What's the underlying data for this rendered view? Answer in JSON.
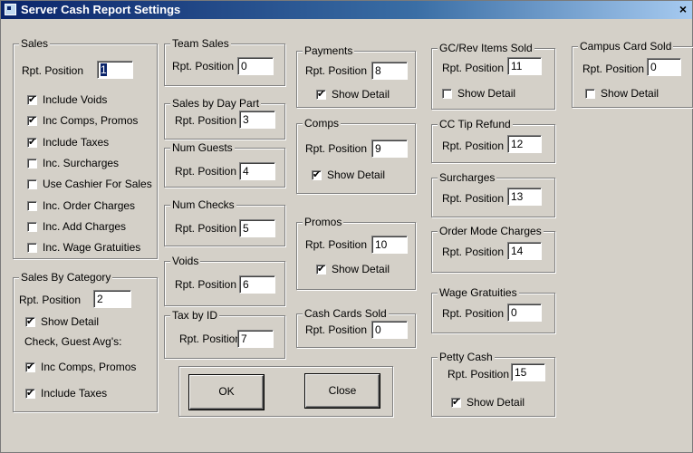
{
  "window": {
    "title": "Server Cash Report Settings",
    "close_glyph": "×"
  },
  "common": {
    "rpt_position_label": "Rpt. Position",
    "show_detail_label": "Show Detail"
  },
  "sales": {
    "title": "Sales",
    "rpt_position": "1",
    "checks": [
      {
        "label": "Include Voids",
        "checked": true
      },
      {
        "label": "Inc Comps, Promos",
        "checked": true
      },
      {
        "label": "Include Taxes",
        "checked": true
      },
      {
        "label": "Inc. Surcharges",
        "checked": false
      },
      {
        "label": "Use Cashier For Sales",
        "checked": false
      },
      {
        "label": "Inc. Order Charges",
        "checked": false
      },
      {
        "label": "Inc. Add Charges",
        "checked": false
      },
      {
        "label": "Inc. Wage Gratuities",
        "checked": false
      }
    ]
  },
  "sales_by_category": {
    "title": "Sales By Category",
    "rpt_position": "2",
    "show_detail": true,
    "avg_label": "Check, Guest Avg's:",
    "checks": [
      {
        "label": "Inc Comps, Promos",
        "checked": true
      },
      {
        "label": "Include Taxes",
        "checked": true
      }
    ]
  },
  "team_sales": {
    "title": "Team Sales",
    "rpt_position": "0"
  },
  "sales_by_day_part": {
    "title": "Sales by Day Part",
    "rpt_position": "3"
  },
  "num_guests": {
    "title": "Num Guests",
    "rpt_position": "4"
  },
  "num_checks": {
    "title": "Num Checks",
    "rpt_position": "5"
  },
  "voids": {
    "title": "Voids",
    "rpt_position": "6"
  },
  "tax_by_id": {
    "title": "Tax by ID",
    "rpt_position": "7"
  },
  "payments": {
    "title": "Payments",
    "rpt_position": "8",
    "show_detail": true
  },
  "comps": {
    "title": "Comps",
    "rpt_position": "9",
    "show_detail": true
  },
  "promos": {
    "title": "Promos",
    "rpt_position": "10",
    "show_detail": true
  },
  "cash_cards_sold": {
    "title": "Cash Cards Sold",
    "rpt_position": "0"
  },
  "gc_rev_items_sold": {
    "title": "GC/Rev Items Sold",
    "rpt_position": "11",
    "show_detail": false
  },
  "cc_tip_refund": {
    "title": "CC Tip Refund",
    "rpt_position": "12"
  },
  "surcharges": {
    "title": "Surcharges",
    "rpt_position": "13"
  },
  "order_mode_charges": {
    "title": "Order Mode Charges",
    "rpt_position": "14"
  },
  "wage_gratuities": {
    "title": "Wage Gratuities",
    "rpt_position": "0"
  },
  "petty_cash": {
    "title": "Petty Cash",
    "rpt_position": "15",
    "show_detail": true
  },
  "campus_card_sold": {
    "title": "Campus Card Sold",
    "rpt_position": "0",
    "show_detail": false
  },
  "buttons": {
    "ok": "OK",
    "close": "Close"
  }
}
